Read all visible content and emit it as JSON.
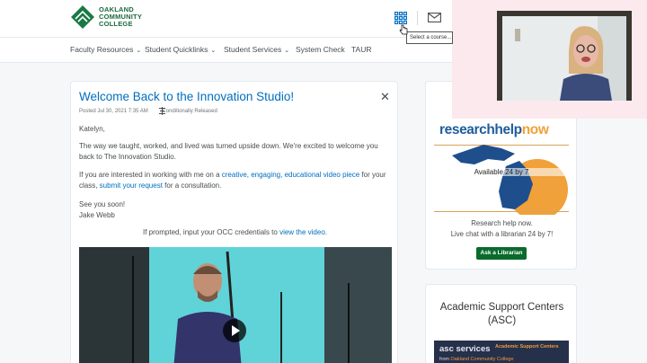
{
  "header": {
    "logo_line1": "OAKLAND",
    "logo_line2": "COMMUNITY",
    "logo_line3": "COLLEGE",
    "tooltip": "Select a course..."
  },
  "nav": [
    {
      "label": "Faculty Resources",
      "has_menu": true
    },
    {
      "label": "Student Quicklinks",
      "has_menu": true
    },
    {
      "label": "Student Services",
      "has_menu": true
    },
    {
      "label": "System Check",
      "has_menu": false
    },
    {
      "label": "TAUR",
      "has_menu": false
    }
  ],
  "post": {
    "title": "Welcome Back to the Innovation Studio!",
    "posted": "Posted Jul 30, 2021 7:35 AM",
    "release": "Conditionally Released",
    "greeting": "Katelyn,",
    "p1": "The way we taught, worked, and lived was turned upside down. We're excited to welcome you back to The Innovation Studio.",
    "p2_pre": "If you are interested in working with me on a ",
    "p2_link1": "creative, engaging, educational video piece",
    "p2_mid1": " for your class, ",
    "p2_link2": "submit your request",
    "p2_post": " for a consultation.",
    "signoff": "See you soon!",
    "signature": "Jake Webb",
    "prompt_pre": "If prompted, input your OCC credentials to ",
    "prompt_link": "view the video."
  },
  "research_widget": {
    "brand_a": "researchhelp",
    "brand_b": "now",
    "available": "Available 24 by 7",
    "line1": "Research help now.",
    "line2": "Live chat with a librarian 24 by 7!",
    "button": "Ask a Librarian"
  },
  "asc_widget": {
    "title": "Academic Support Centers (ASC)",
    "banner_title": "asc services",
    "banner_from_pre": "from ",
    "banner_from": "Oakland Community College",
    "banner_tag": "Academic Support Centers"
  },
  "colors": {
    "link": "#006fbf",
    "brand_green": "#1a6b3c",
    "button_green": "#0a6b2c",
    "rhn_blue": "#1f5d9c",
    "rhn_orange": "#f0a13a"
  }
}
